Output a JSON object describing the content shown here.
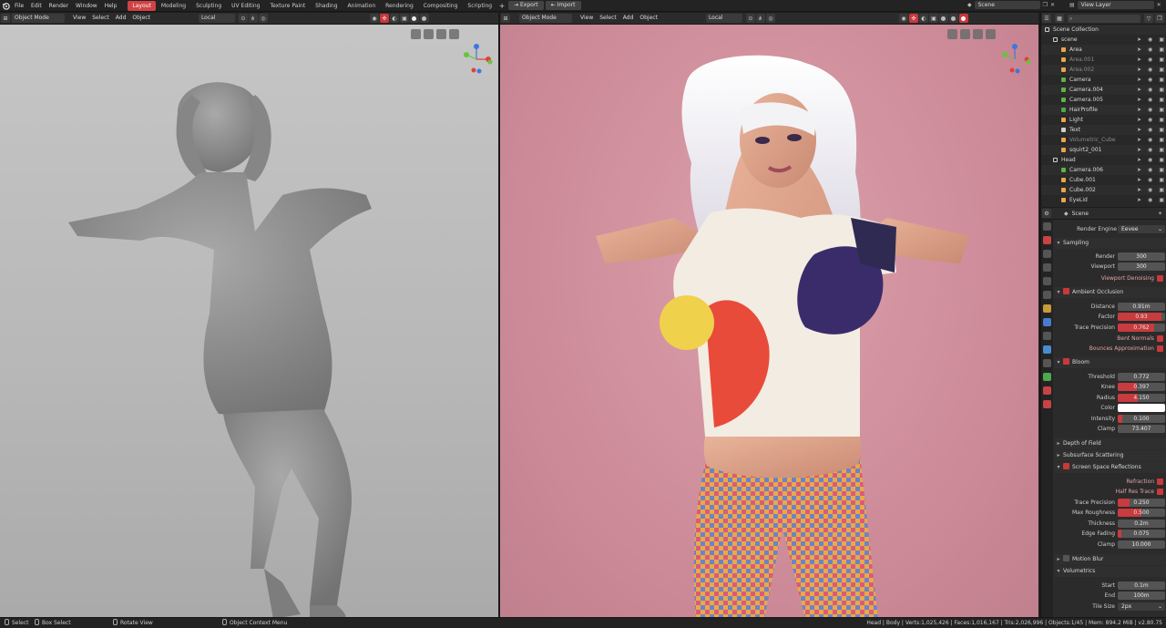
{
  "menu": {
    "items": [
      "File",
      "Edit",
      "Render",
      "Window",
      "Help"
    ]
  },
  "workspaces": [
    "Layout",
    "Modeling",
    "Sculpting",
    "UV Editing",
    "Texture Paint",
    "Shading",
    "Animation",
    "Rendering",
    "Compositing",
    "Scripting"
  ],
  "active_workspace": "Layout",
  "topbar": {
    "export_label": "Export",
    "import_label": "Import",
    "scene_name": "Scene",
    "view_layer": "View Layer"
  },
  "viewport_left": {
    "mode": "Object Mode",
    "menus": [
      "View",
      "Select",
      "Add",
      "Object"
    ],
    "orientation": "Local"
  },
  "viewport_right": {
    "mode": "Object Mode",
    "menus": [
      "View",
      "Select",
      "Add",
      "Object"
    ],
    "orientation": "Local"
  },
  "outliner": {
    "rows": [
      {
        "label": "Scene Collection",
        "indent": 0,
        "muted": false,
        "type": "collection"
      },
      {
        "label": "scene",
        "indent": 1,
        "muted": false,
        "type": "collection"
      },
      {
        "label": "Area",
        "indent": 2,
        "muted": false,
        "type": "light"
      },
      {
        "label": "Area.001",
        "indent": 2,
        "muted": true,
        "type": "light"
      },
      {
        "label": "Area.002",
        "indent": 2,
        "muted": true,
        "type": "light"
      },
      {
        "label": "Camera",
        "indent": 2,
        "muted": false,
        "type": "camera"
      },
      {
        "label": "Camera.004",
        "indent": 2,
        "muted": false,
        "type": "camera"
      },
      {
        "label": "Camera.005",
        "indent": 2,
        "muted": false,
        "type": "camera"
      },
      {
        "label": "HairProfile",
        "indent": 2,
        "muted": false,
        "type": "curve"
      },
      {
        "label": "Light",
        "indent": 2,
        "muted": false,
        "type": "light"
      },
      {
        "label": "Text",
        "indent": 2,
        "muted": false,
        "type": "text"
      },
      {
        "label": "Volumetric_Cube",
        "indent": 2,
        "muted": true,
        "type": "mesh"
      },
      {
        "label": "squirt2_001",
        "indent": 2,
        "muted": false,
        "type": "mesh"
      },
      {
        "label": "Head",
        "indent": 1,
        "muted": false,
        "type": "collection"
      },
      {
        "label": "Camera.006",
        "indent": 2,
        "muted": false,
        "type": "camera"
      },
      {
        "label": "Cube.001",
        "indent": 2,
        "muted": false,
        "type": "mesh"
      },
      {
        "label": "Cube.002",
        "indent": 2,
        "muted": false,
        "type": "mesh"
      },
      {
        "label": "EyeLid",
        "indent": 2,
        "muted": false,
        "type": "mesh"
      }
    ]
  },
  "properties": {
    "context": "Scene",
    "render_engine_label": "Render Engine",
    "render_engine": "Eevee",
    "sections": {
      "sampling": "Sampling",
      "ambient_occlusion": "Ambient Occlusion",
      "bloom": "Bloom",
      "depth_of_field": "Depth of Field",
      "subsurface": "Subsurface Scattering",
      "ssr": "Screen Space Reflections",
      "motion_blur": "Motion Blur",
      "volumetrics": "Volumetrics"
    },
    "sampling": {
      "render_label": "Render",
      "render": "300",
      "viewport_label": "Viewport",
      "viewport": "300",
      "denoise_label": "Viewport Denoising"
    },
    "ao": {
      "distance_label": "Distance",
      "distance": "0.91m",
      "factor_label": "Factor",
      "factor": "0.93",
      "factor_fill": 0.93,
      "trace_label": "Trace Precision",
      "trace": "0.762",
      "trace_fill": 0.762,
      "bent_label": "Bent Normals",
      "bounce_label": "Bounces Approximation"
    },
    "bloom": {
      "threshold_label": "Threshold",
      "threshold": "0.772",
      "knee_label": "Knee",
      "knee": "0.397",
      "knee_fill": 0.397,
      "radius_label": "Radius",
      "radius": "4.150",
      "radius_fill": 0.415,
      "color_label": "Color",
      "color": "#ffffff",
      "intensity_label": "Intensity",
      "intensity": "0.100",
      "intensity_fill": 0.1,
      "clamp_label": "Clamp",
      "clamp": "73.407"
    },
    "ssr": {
      "refraction_label": "Refraction",
      "half_res_label": "Half Res Trace",
      "trace_label": "Trace Precision",
      "trace": "0.250",
      "trace_fill": 0.25,
      "rough_label": "Max Roughness",
      "rough": "0.500",
      "rough_fill": 0.5,
      "thick_label": "Thickness",
      "thick": "0.2m",
      "edge_label": "Edge Fading",
      "edge": "0.075",
      "edge_fill": 0.075,
      "clamp_label": "Clamp",
      "clamp": "10.000"
    },
    "vol": {
      "start_label": "Start",
      "start": "0.1m",
      "end_label": "End",
      "end": "100m",
      "tile_label": "Tile Size",
      "tile": "2px"
    }
  },
  "status": {
    "select": "Select",
    "box_select": "Box Select",
    "rotate_view": "Rotate View",
    "context_menu": "Object Context Menu",
    "stats": "Head | Body | Verts:1,025,426 | Faces:1,016,167 | Tris:2,026,996 | Objects:1/45 | Mem: 894.2 MiB | v2.80.75"
  },
  "colors": {
    "accent": "#d04245",
    "background_render": "#cf8c99"
  }
}
